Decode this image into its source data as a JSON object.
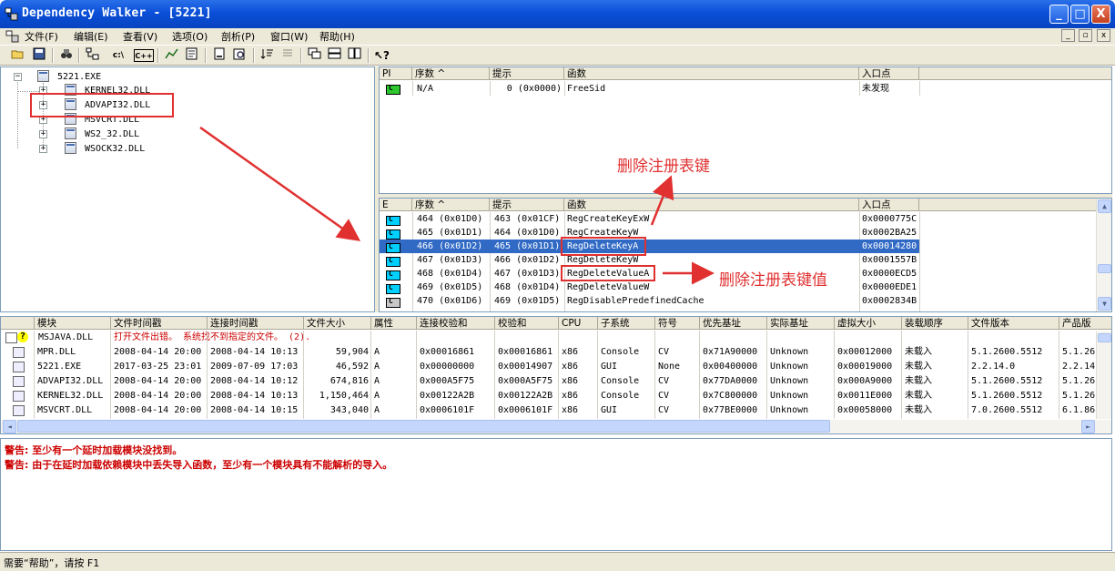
{
  "window": {
    "title": "Dependency Walker - [5221]",
    "min": "_",
    "max": "□",
    "close": "X"
  },
  "menu": {
    "items": [
      "文件(F)",
      "编辑(E)",
      "查看(V)",
      "选项(O)",
      "剖析(P)",
      "窗口(W)",
      "帮助(H)"
    ]
  },
  "toolbar": {
    "buttons": [
      "open",
      "save",
      "find",
      "path",
      "c:\\",
      "C++",
      "view",
      "props",
      "copy",
      "search",
      "sort",
      "sort2",
      "cascade",
      "horiz",
      "vert",
      "help"
    ],
    "labels": {
      "c": "c:\\",
      "cpp": "C++"
    }
  },
  "tree": {
    "root": "5221.EXE",
    "children": [
      "KERNEL32.DLL",
      "ADVAPI32.DLL",
      "MSVCRT.DLL",
      "WS2_32.DLL",
      "WSOCK32.DLL"
    ],
    "highlighted": "ADVAPI32.DLL"
  },
  "imports": {
    "headers": {
      "pi": "PI",
      "ordinal": "序数 ^",
      "hint": "提示",
      "function": "函数",
      "entry": "入口点"
    },
    "rows": [
      {
        "ordinal": "N/A",
        "hint": "0 (0x0000)",
        "function": "FreeSid",
        "entry": "未发现"
      }
    ]
  },
  "exports": {
    "headers": {
      "e": "E",
      "ordinal": "序数 ^",
      "hint": "提示",
      "function": "函数",
      "entry": "入口点"
    },
    "rows": [
      {
        "ordinal": "464 (0x01D0)",
        "hint": "463 (0x01CF)",
        "function": "RegCreateKeyExW",
        "entry": "0x0000775C"
      },
      {
        "ordinal": "465 (0x01D1)",
        "hint": "464 (0x01D0)",
        "function": "RegCreateKeyW",
        "entry": "0x0002BA25"
      },
      {
        "ordinal": "466 (0x01D2)",
        "hint": "465 (0x01D1)",
        "function": "RegDeleteKeyA",
        "entry": "0x00014280"
      },
      {
        "ordinal": "467 (0x01D3)",
        "hint": "466 (0x01D2)",
        "function": "RegDeleteKeyW",
        "entry": "0x0001557B"
      },
      {
        "ordinal": "468 (0x01D4)",
        "hint": "467 (0x01D3)",
        "function": "RegDeleteValueA",
        "entry": "0x0000ECD5"
      },
      {
        "ordinal": "469 (0x01D5)",
        "hint": "468 (0x01D4)",
        "function": "RegDeleteValueW",
        "entry": "0x0000EDE1"
      },
      {
        "ordinal": "470 (0x01D6)",
        "hint": "469 (0x01D5)",
        "function": "RegDisablePredefinedCache",
        "entry": "0x0002834B"
      }
    ],
    "selected_index": 2
  },
  "annotations": {
    "delete_key": "删除注册表键",
    "delete_value": "删除注册表键值"
  },
  "modules": {
    "headers": [
      "模块",
      "文件时间戳",
      "连接时间戳",
      "文件大小",
      "属性",
      "连接校验和",
      "校验和",
      "CPU",
      "子系统",
      "符号",
      "优先基址",
      "实际基址",
      "虚拟大小",
      "装载顺序",
      "文件版本",
      "产品版"
    ],
    "error_row": {
      "module": "MSJAVA.DLL",
      "message": "打开文件出错。 系统找不到指定的文件。 (2)."
    },
    "rows": [
      [
        "MPR.DLL",
        "2008-04-14 20:00",
        "2008-04-14 10:13",
        "59,904",
        "A",
        "0x00016861",
        "0x00016861",
        "x86",
        "Console",
        "CV",
        "0x71A90000",
        "Unknown",
        "0x00012000",
        "未载入",
        "5.1.2600.5512",
        "5.1.26"
      ],
      [
        "5221.EXE",
        "2017-03-25 23:01",
        "2009-07-09 17:03",
        "46,592",
        "A",
        "0x00000000",
        "0x00014907",
        "x86",
        "GUI",
        "None",
        "0x00400000",
        "Unknown",
        "0x00019000",
        "未载入",
        "2.2.14.0",
        "2.2.14"
      ],
      [
        "ADVAPI32.DLL",
        "2008-04-14 20:00",
        "2008-04-14 10:12",
        "674,816",
        "A",
        "0x000A5F75",
        "0x000A5F75",
        "x86",
        "Console",
        "CV",
        "0x77DA0000",
        "Unknown",
        "0x000A9000",
        "未载入",
        "5.1.2600.5512",
        "5.1.26"
      ],
      [
        "KERNEL32.DLL",
        "2008-04-14 20:00",
        "2008-04-14 10:13",
        "1,150,464",
        "A",
        "0x00122A2B",
        "0x00122A2B",
        "x86",
        "Console",
        "CV",
        "0x7C800000",
        "Unknown",
        "0x0011E000",
        "未载入",
        "5.1.2600.5512",
        "5.1.26"
      ],
      [
        "MSVCRT.DLL",
        "2008-04-14 20:00",
        "2008-04-14 10:15",
        "343,040",
        "A",
        "0x0006101F",
        "0x0006101F",
        "x86",
        "GUI",
        "CV",
        "0x77BE0000",
        "Unknown",
        "0x00058000",
        "未载入",
        "7.0.2600.5512",
        "6.1.86"
      ]
    ]
  },
  "log": {
    "lines": [
      "警告: 至少有一个延时加载模块没找到。",
      "警告: 由于在延时加载依赖模块中丢失导入函数，至少有一个模块具有不能解析的导入。"
    ]
  },
  "status": {
    "text": "需要“帮助”，请按 F1"
  }
}
